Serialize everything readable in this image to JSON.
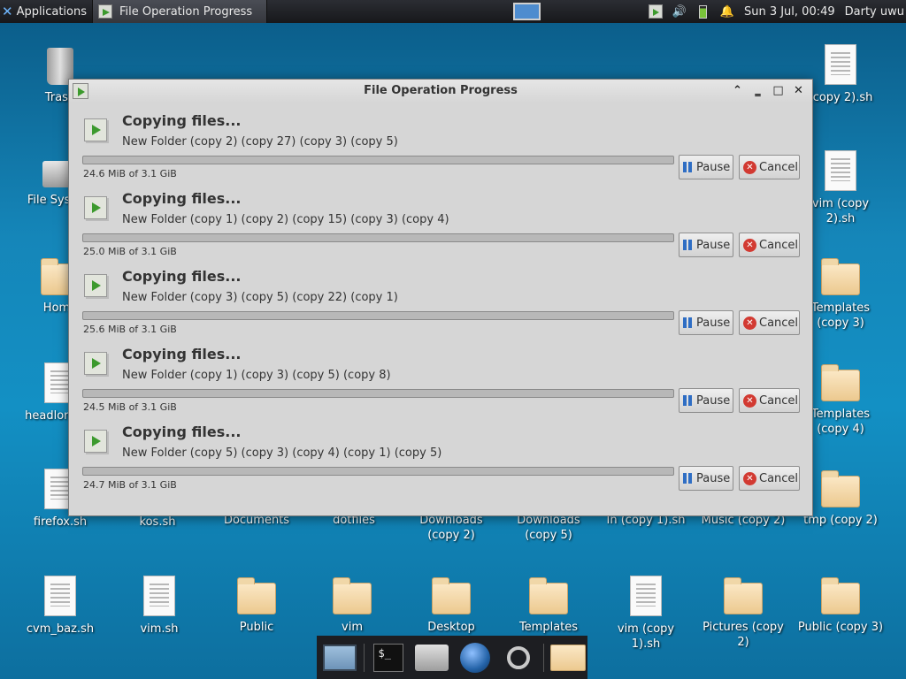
{
  "panel": {
    "applications_label": "Applications",
    "task_title": "File Operation Progress",
    "clock": "Sun  3 Jul, 00:49",
    "user": "Darty uwu",
    "volume_icon": "speaker-icon",
    "notification_icon": "bell-icon"
  },
  "desktop": {
    "icons": [
      {
        "label": "Trash"
      },
      {
        "label": "File System"
      },
      {
        "label": "Home"
      },
      {
        "label": "headlong.sh"
      },
      {
        "label": "firefox.sh"
      },
      {
        "label": "kos.sh"
      },
      {
        "label": "Documents"
      },
      {
        "label": "dotfiles"
      },
      {
        "label": "Downloads (copy 2)"
      },
      {
        "label": "Downloads (copy 5)"
      },
      {
        "label": "In (copy 1).sh"
      },
      {
        "label": "Music (copy 2)"
      },
      {
        "label": "tmp (copy 2)"
      },
      {
        "label": "(copy 2).sh"
      },
      {
        "label": "vim (copy 2).sh"
      },
      {
        "label": "Templates (copy 3)"
      },
      {
        "label": "Templates (copy 4)"
      },
      {
        "label": "cvm_baz.sh"
      },
      {
        "label": "vim.sh"
      },
      {
        "label": "Public"
      },
      {
        "label": "vim"
      },
      {
        "label": "Desktop"
      },
      {
        "label": "Templates"
      },
      {
        "label": "vim (copy 1).sh"
      },
      {
        "label": "Pictures (copy 2)"
      },
      {
        "label": "Public (copy 3)"
      }
    ]
  },
  "dialog": {
    "title": "File Operation Progress",
    "pause_label": "Pause",
    "cancel_label": "Cancel",
    "operations": [
      {
        "heading": "Copying files...",
        "detail": "New Folder (copy 2) (copy 27) (copy 3) (copy 5)",
        "size": "24.6 MiB of 3.1 GiB",
        "progress": 0.0
      },
      {
        "heading": "Copying files...",
        "detail": "New Folder (copy 1) (copy 2) (copy 15) (copy 3) (copy 4)",
        "size": "25.0 MiB of 3.1 GiB",
        "progress": 0.0
      },
      {
        "heading": "Copying files...",
        "detail": "New Folder (copy 3) (copy 5) (copy 22) (copy 1)",
        "size": "25.6 MiB of 3.1 GiB",
        "progress": 0.0
      },
      {
        "heading": "Copying files...",
        "detail": "New Folder (copy 1) (copy 3) (copy 5) (copy 8)",
        "size": "24.5 MiB of 3.1 GiB",
        "progress": 0.0
      },
      {
        "heading": "Copying files...",
        "detail": "New Folder (copy 5) (copy 3) (copy 4) (copy 1) (copy 5)",
        "size": "24.7 MiB of 3.1 GiB",
        "progress": 0.0
      }
    ]
  },
  "dock": {
    "terminal_text": "$_"
  }
}
